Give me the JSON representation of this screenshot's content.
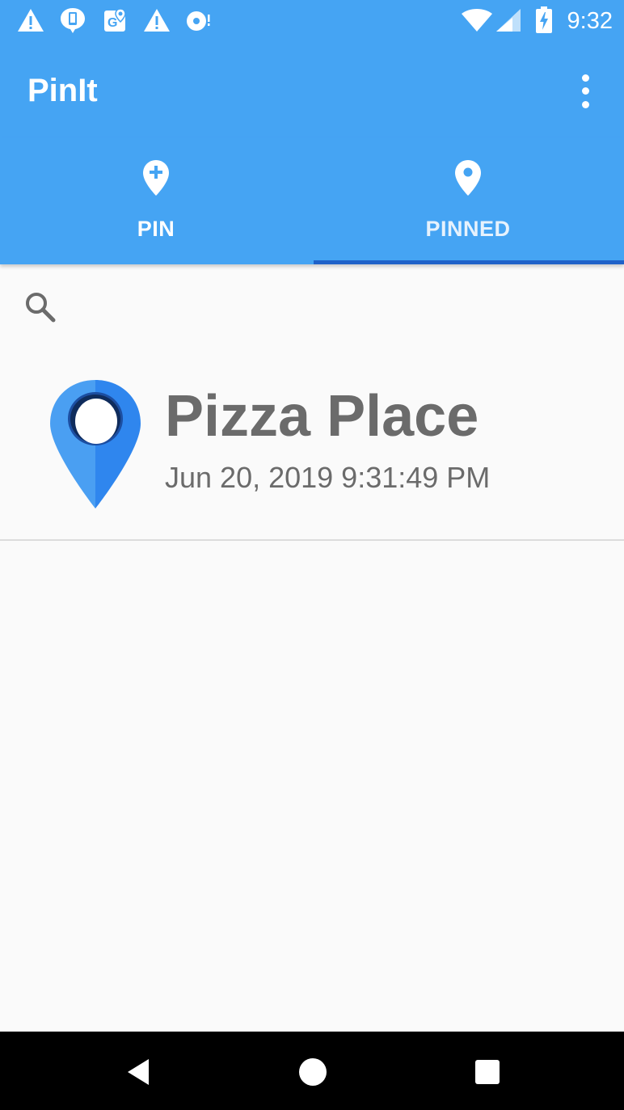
{
  "status_bar": {
    "time": "9:32",
    "notification_icons": [
      "warning-icon",
      "phone-chat-icon",
      "maps-icon",
      "warning-icon",
      "disc-icon"
    ],
    "system_icons": [
      "wifi-icon",
      "signal-icon",
      "battery-charging-icon"
    ]
  },
  "app_bar": {
    "title": "PinIt",
    "menu_icon": "more-vert-icon"
  },
  "tabs": [
    {
      "label": "PIN",
      "icon": "add-location-icon",
      "selected": false
    },
    {
      "label": "PINNED",
      "icon": "location-icon",
      "selected": true
    }
  ],
  "search": {
    "icon": "search-icon"
  },
  "pinned_items": [
    {
      "title": "Pizza Place",
      "date": "Jun 20, 2019 9:31:49 PM",
      "icon": "map-pin-icon"
    }
  ],
  "nav_bar": {
    "buttons": [
      "back-icon",
      "home-icon",
      "recents-icon"
    ]
  },
  "colors": {
    "primary": "#45a4f3",
    "tab_indicator": "#1f62c9",
    "item_text": "#6b6b6b",
    "background": "#fafafa"
  }
}
